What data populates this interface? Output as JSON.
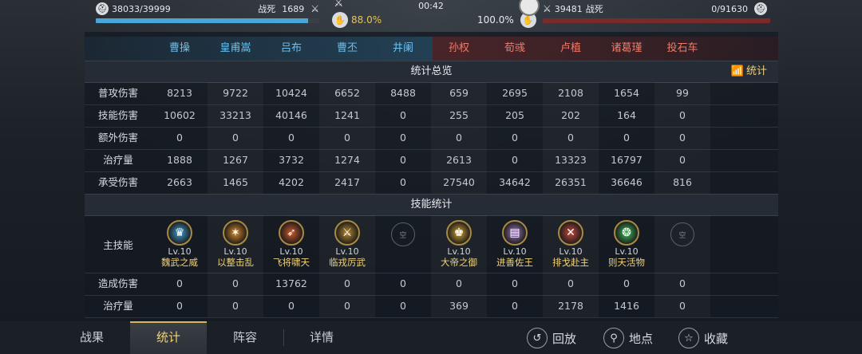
{
  "top": {
    "left": {
      "hp": "38033/39999",
      "death_label": "战死",
      "death_count": "1689"
    },
    "right": {
      "count": "39481",
      "death_label": "战死",
      "hp": "0/91630"
    },
    "timer": "00:42",
    "left_pct": "88.0%",
    "right_pct": "100.0%",
    "left_hp_fraction": 0.95,
    "right_hp_fraction": 0.0
  },
  "header": {
    "blue": [
      "曹操",
      "皇甫嵩",
      "吕布",
      "曹丕",
      "井阑"
    ],
    "red": [
      "孙权",
      "荀彧",
      "卢植",
      "诸葛瑾",
      "投石车"
    ]
  },
  "sections": {
    "overview": "统计总览",
    "skills": "技能统计",
    "stats_button": "统计"
  },
  "rows": [
    {
      "label": "普攻伤害",
      "values": [
        "8213",
        "9722",
        "10424",
        "6652",
        "8488",
        "659",
        "2695",
        "2108",
        "1654",
        "99"
      ]
    },
    {
      "label": "技能伤害",
      "values": [
        "10602",
        "33213",
        "40146",
        "1241",
        "0",
        "255",
        "205",
        "202",
        "164",
        "0"
      ]
    },
    {
      "label": "额外伤害",
      "values": [
        "0",
        "0",
        "0",
        "0",
        "0",
        "0",
        "0",
        "0",
        "0",
        "0"
      ]
    },
    {
      "label": "治疗量",
      "values": [
        "1888",
        "1267",
        "3732",
        "1274",
        "0",
        "2613",
        "0",
        "13323",
        "16797",
        "0"
      ]
    },
    {
      "label": "承受伤害",
      "values": [
        "2663",
        "1465",
        "4202",
        "2417",
        "0",
        "27540",
        "34642",
        "26351",
        "36646",
        "816"
      ]
    }
  ],
  "skills": {
    "label": "主技能",
    "items": [
      {
        "lv": "Lv.10",
        "name": "魏武之威",
        "icon": "wei-crown-icon",
        "color": "#3d9ed6"
      },
      {
        "lv": "Lv.10",
        "name": "以整击乱",
        "icon": "spear-burst-icon",
        "color": "#d98a2a"
      },
      {
        "lv": "Lv.10",
        "name": "飞将啸天",
        "icon": "arrows-icon",
        "color": "#d05a2a"
      },
      {
        "lv": "Lv.10",
        "name": "临戎厉武",
        "icon": "warrior-icon",
        "color": "#b8892e"
      },
      {
        "empty": "空"
      },
      {
        "lv": "Lv.10",
        "name": "大帝之御",
        "icon": "emperor-icon",
        "color": "#d0a030"
      },
      {
        "lv": "Lv.10",
        "name": "进善佐王",
        "icon": "scroll-icon",
        "color": "#9b7ab8"
      },
      {
        "lv": "Lv.10",
        "name": "排戈赴主",
        "icon": "crossed-blades-icon",
        "color": "#c44a3a"
      },
      {
        "lv": "Lv.10",
        "name": "则天活物",
        "icon": "green-vortex-icon",
        "color": "#3fbf5a"
      },
      {
        "empty": "空"
      }
    ]
  },
  "skill_rows": [
    {
      "label": "造成伤害",
      "values": [
        "0",
        "0",
        "13762",
        "0",
        "0",
        "0",
        "0",
        "0",
        "0",
        "0"
      ]
    },
    {
      "label": "治疗量",
      "values": [
        "0",
        "0",
        "0",
        "0",
        "0",
        "369",
        "0",
        "2178",
        "1416",
        "0"
      ]
    }
  ],
  "tabs": [
    "战果",
    "统计",
    "阵容",
    "详情"
  ],
  "active_tab": "统计",
  "actions": [
    {
      "label": "回放",
      "icon": "replay-icon"
    },
    {
      "label": "地点",
      "icon": "location-pin-icon"
    },
    {
      "label": "收藏",
      "icon": "star-icon"
    }
  ],
  "colors": {
    "blue_team": "#6cc0ee",
    "red_team": "#f07a6a",
    "gold": "#f0d27a"
  }
}
